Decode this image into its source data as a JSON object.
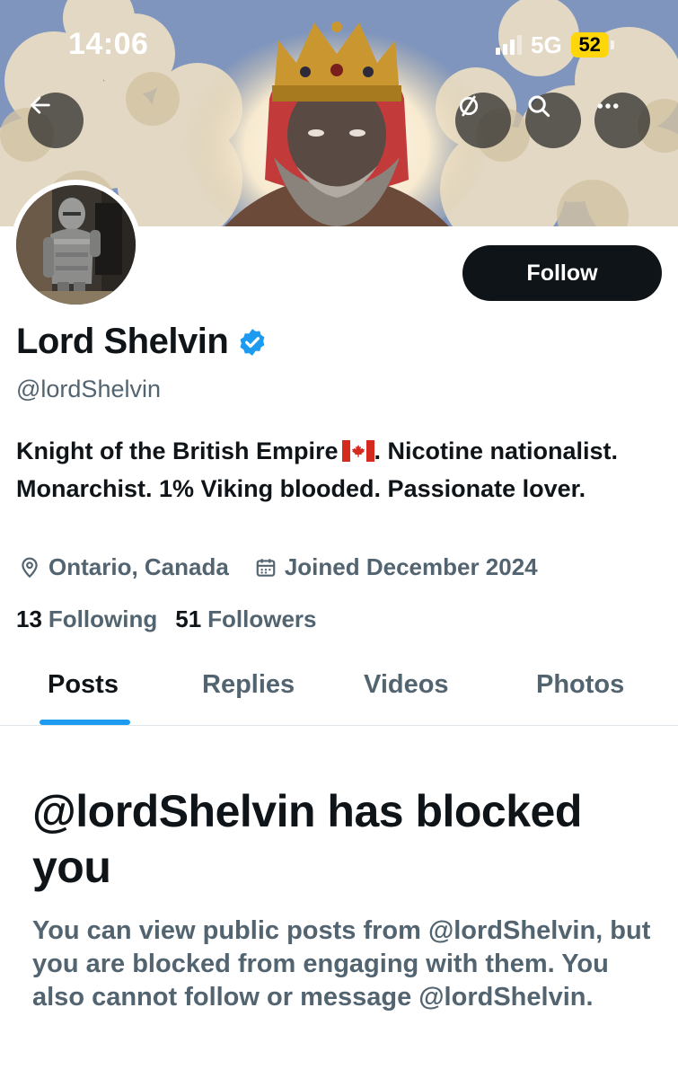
{
  "status_bar": {
    "time": "14:06",
    "network": "5G",
    "battery": "52"
  },
  "banner": {
    "description_icon": "crowned-king-painting"
  },
  "header_actions": {
    "back_icon": "arrow-left-icon",
    "no_notifications_icon": "bell-slash-icon",
    "search_icon": "search-icon",
    "more_icon": "more-horizontal-icon"
  },
  "profile": {
    "display_name": "Lord Shelvin",
    "handle": "@lordShelvin",
    "verified": true,
    "bio_part1": "Knight of the British Empire",
    "bio_part2": ". Nicotine nationalist. Monarchist. 1% Viking blooded. Passionate lover.",
    "location": "Ontario, Canada",
    "joined": "Joined December 2024",
    "following_count": "13",
    "following_label": "Following",
    "followers_count": "51",
    "followers_label": "Followers",
    "follow_button": "Follow"
  },
  "tabs": [
    {
      "label": "Posts",
      "active": true
    },
    {
      "label": "Replies",
      "active": false
    },
    {
      "label": "Videos",
      "active": false
    },
    {
      "label": "Photos",
      "active": false
    }
  ],
  "blocked": {
    "title": "@lordShelvin has blocked you",
    "description": "You can view public posts from @lordShelvin, but you are blocked from engaging with them. You also cannot follow or message @lordShelvin."
  },
  "colors": {
    "accent": "#1d9bf0",
    "text_primary": "#0f1419",
    "text_secondary": "#536471",
    "battery": "#ffd60a"
  }
}
